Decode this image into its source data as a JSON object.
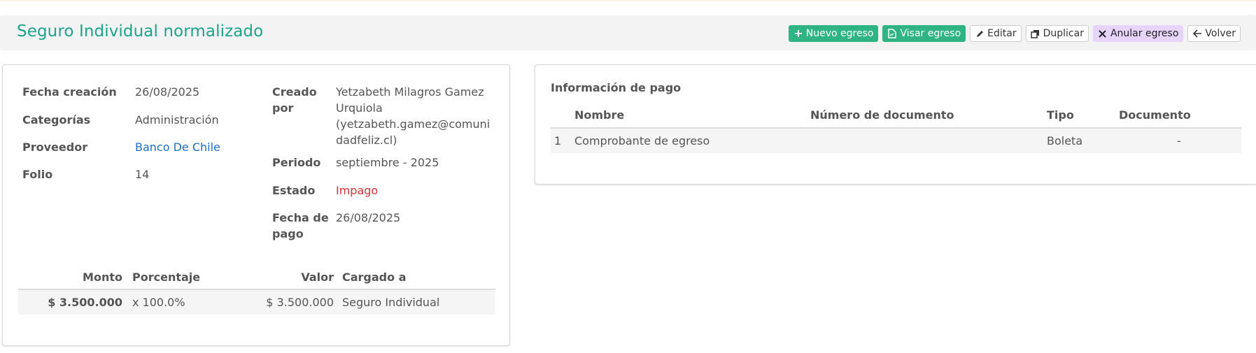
{
  "header": {
    "title": "Seguro Individual normalizado",
    "actions": {
      "nuevo": "Nuevo egreso",
      "visar": "Visar egreso",
      "editar": "Editar",
      "duplicar": "Duplicar",
      "anular": "Anular egreso",
      "volver": "Volver"
    }
  },
  "details": {
    "fecha_creacion_label": "Fecha creación",
    "fecha_creacion": "26/08/2025",
    "categorias_label": "Categorías",
    "categorias": "Administración",
    "proveedor_label": "Proveedor",
    "proveedor": "Banco De Chile",
    "folio_label": "Folio",
    "folio": "14",
    "creado_por_label_1": "Creado",
    "creado_por_label_2": "por",
    "creado_por_1": "Yetzabeth Milagros Gamez",
    "creado_por_2": "Urquiola",
    "creado_por_3": "(yetzabeth.gamez@comuni",
    "creado_por_4": "dadfeliz.cl)",
    "periodo_label": "Periodo",
    "periodo": "septiembre - 2025",
    "estado_label": "Estado",
    "estado": "Impago",
    "fecha_pago_label_1": "Fecha de",
    "fecha_pago_label_2": "pago",
    "fecha_pago": "26/08/2025"
  },
  "charges": {
    "headers": [
      "Monto",
      "Porcentaje",
      "Valor",
      "Cargado a"
    ],
    "rows": [
      {
        "monto": "$ 3.500.000",
        "porcentaje": "x 100.0%",
        "valor": "$ 3.500.000",
        "cargado_a": "Seguro Individual"
      }
    ]
  },
  "payment": {
    "title": "Información de pago",
    "headers": [
      "Nombre",
      "Número de documento",
      "Tipo",
      "Documento"
    ],
    "rows": [
      {
        "index": "1",
        "nombre": "Comprobante de egreso",
        "numero": "",
        "tipo": "Boleta",
        "documento": "-"
      }
    ]
  },
  "colors": {
    "title": "#1aa58a",
    "green_button": "#2fb483",
    "purple_button": "#e6d4fa",
    "link": "#1b6fc7",
    "danger": "#d9323a"
  }
}
